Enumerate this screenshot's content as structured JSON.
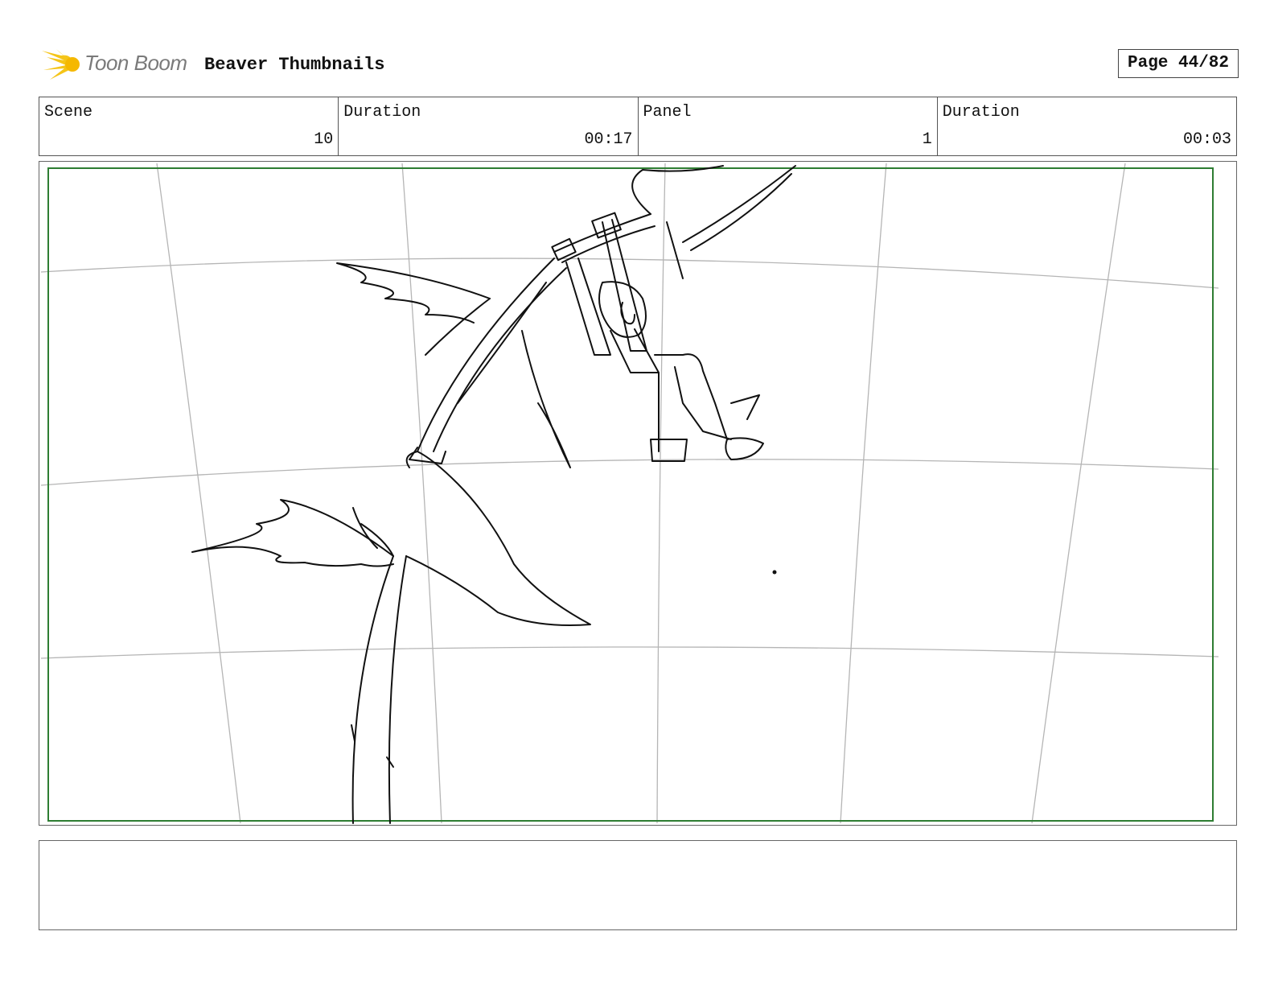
{
  "header": {
    "logo_text": "Toon Boom",
    "project_title": "Beaver Thumbnails",
    "page_label": "Page 44/82"
  },
  "info": {
    "scene_label": "Scene",
    "scene_value": "10",
    "scene_duration_label": "Duration",
    "scene_duration_value": "00:17",
    "panel_label": "Panel",
    "panel_value": "1",
    "panel_duration_label": "Duration",
    "panel_duration_value": "00:03"
  },
  "colors": {
    "safe_frame": "#2e7d32",
    "logo_yellow": "#f5c518",
    "grid": "#b5b5b5",
    "sketch": "#111111"
  }
}
